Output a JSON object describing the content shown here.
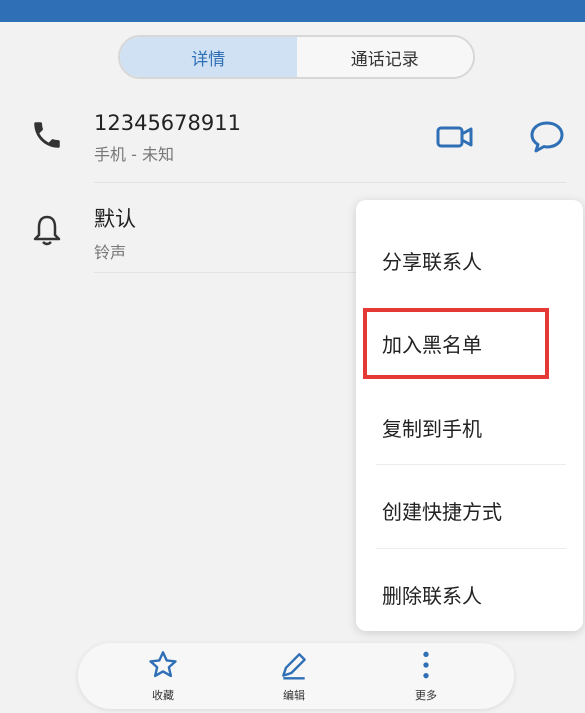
{
  "tabs": {
    "details": "详情",
    "call_log": "通话记录"
  },
  "contact": {
    "phone_number": "12345678911",
    "phone_sub": "手机 - 未知",
    "ringtone_title": "默认",
    "ringtone_sub": "铃声"
  },
  "menu": {
    "items": [
      "分享联系人",
      "加入黑名单",
      "复制到手机",
      "创建快捷方式",
      "删除联系人"
    ],
    "highlighted_item": "加入黑名单",
    "highlight_color": "#e53935"
  },
  "bottom_bar": {
    "favorite_label": "收藏",
    "edit_label": "编辑",
    "more_label": "更多"
  },
  "colors": {
    "accent": "#2f6fb6",
    "active_tab_bg": "#cfe1f3"
  },
  "icons": {
    "phone": "phone-icon",
    "bell": "bell-icon",
    "video": "video-call-icon",
    "message": "message-icon",
    "star": "star-icon",
    "edit": "pencil-icon",
    "more": "more-vertical-icon"
  }
}
